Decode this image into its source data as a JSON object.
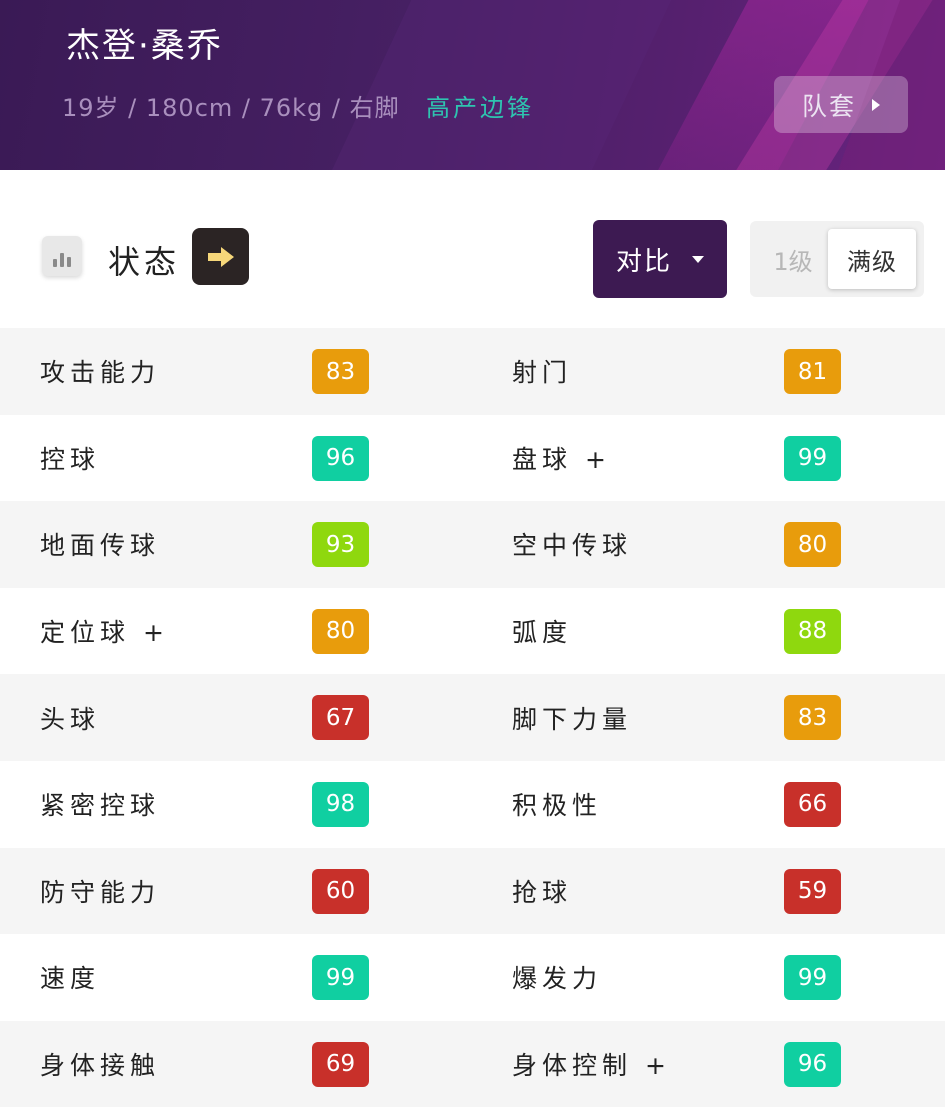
{
  "player": {
    "name": "杰登·桑乔",
    "meta": "19岁 / 180cm / 76kg / 右脚",
    "role": "高产边锋"
  },
  "kit_button": {
    "label": "队套"
  },
  "status": {
    "label": "状态",
    "icon": "bar-chart-icon",
    "arrow_icon": "arrow-right-icon"
  },
  "compare": {
    "label": "对比"
  },
  "level_toggle": {
    "options": [
      "1级",
      "满级"
    ],
    "selected": "满级"
  },
  "colors": {
    "header": "#4a2066",
    "accent_role": "#2ec4b0",
    "compare_button": "#3d1a52",
    "rating_elite": "#10cfa1",
    "rating_great": "#8fd80e",
    "rating_good": "#e89c0c",
    "rating_low": "#c8302a"
  },
  "attributes": [
    {
      "left": {
        "label": "攻击能力",
        "value": "83",
        "tier": "good"
      },
      "right": {
        "label": "射门",
        "value": "81",
        "tier": "good"
      }
    },
    {
      "left": {
        "label": "控球",
        "value": "96",
        "tier": "elite"
      },
      "right": {
        "label": "盘球 +",
        "value": "99",
        "tier": "elite"
      }
    },
    {
      "left": {
        "label": "地面传球",
        "value": "93",
        "tier": "great"
      },
      "right": {
        "label": "空中传球",
        "value": "80",
        "tier": "good"
      }
    },
    {
      "left": {
        "label": "定位球 +",
        "value": "80",
        "tier": "good"
      },
      "right": {
        "label": "弧度",
        "value": "88",
        "tier": "great"
      }
    },
    {
      "left": {
        "label": "头球",
        "value": "67",
        "tier": "low"
      },
      "right": {
        "label": "脚下力量",
        "value": "83",
        "tier": "good"
      }
    },
    {
      "left": {
        "label": "紧密控球",
        "value": "98",
        "tier": "elite"
      },
      "right": {
        "label": "积极性",
        "value": "66",
        "tier": "low"
      }
    },
    {
      "left": {
        "label": "防守能力",
        "value": "60",
        "tier": "low"
      },
      "right": {
        "label": "抢球",
        "value": "59",
        "tier": "low"
      }
    },
    {
      "left": {
        "label": "速度",
        "value": "99",
        "tier": "elite"
      },
      "right": {
        "label": "爆发力",
        "value": "99",
        "tier": "elite"
      }
    },
    {
      "left": {
        "label": "身体接触",
        "value": "69",
        "tier": "low"
      },
      "right": {
        "label": "身体控制 +",
        "value": "96",
        "tier": "elite"
      }
    }
  ]
}
